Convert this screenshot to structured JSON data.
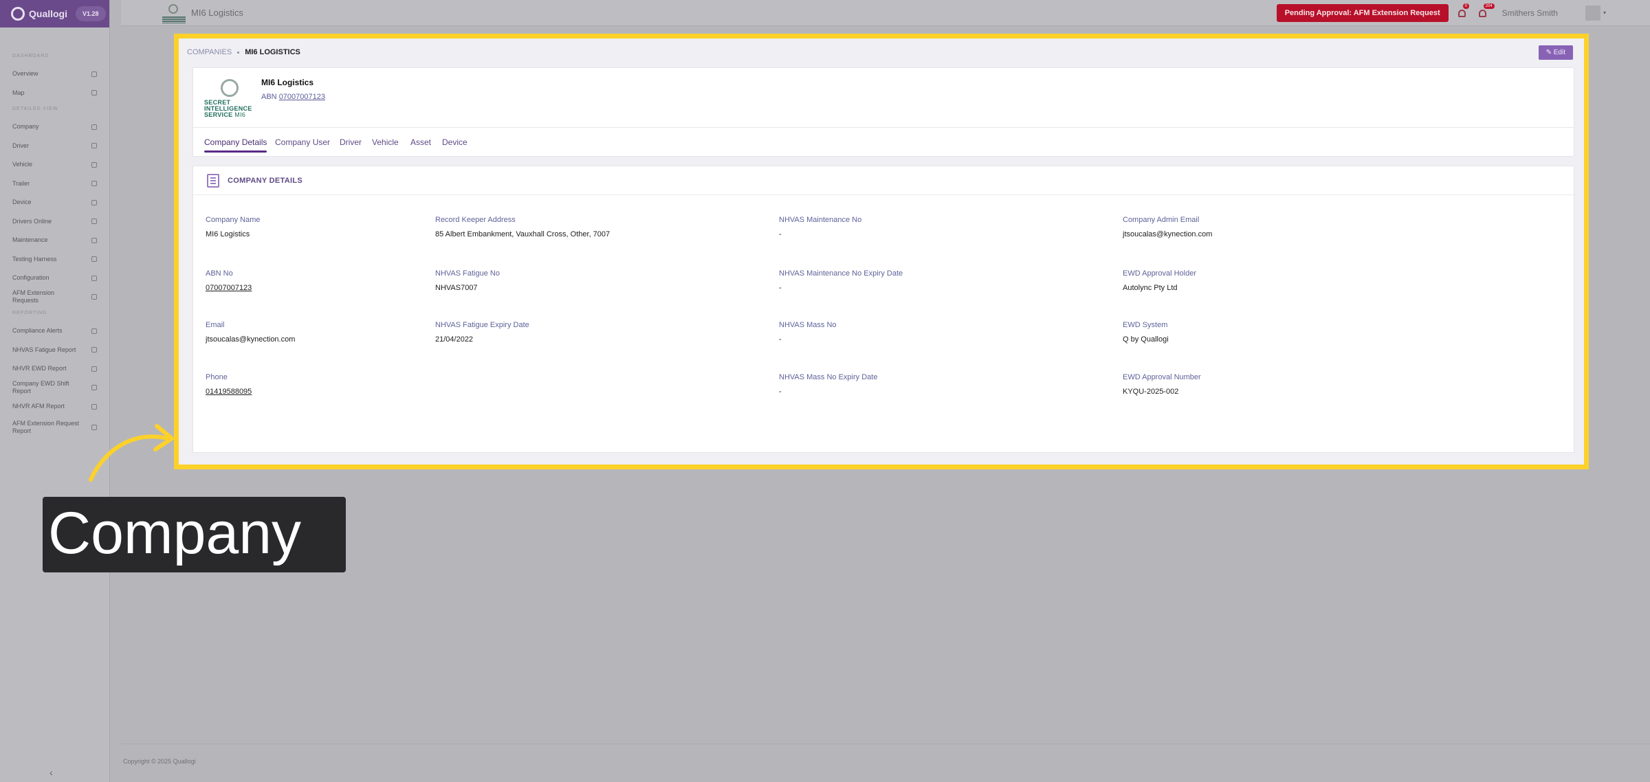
{
  "app": {
    "name": "Quallogi",
    "version": "V1.28"
  },
  "sidebar": {
    "sections": [
      {
        "title": "Dashboard",
        "items": [
          "Overview",
          "Map"
        ]
      },
      {
        "title": "Detailed View",
        "items": [
          "Company",
          "Driver",
          "Vehicle",
          "Trailer",
          "Device",
          "Drivers Online",
          "Maintenance",
          "Testing Harness",
          "Configuration",
          "AFM Extension Requests"
        ]
      },
      {
        "title": "Reporting",
        "items": [
          "Compliance Alerts",
          "NHVAS Fatigue Report",
          "NHVR EWD Report",
          "Company EWD Shift Report",
          "NHVR AFM Report",
          "AFM Extension Request Report"
        ]
      }
    ],
    "collapse_glyph": "‹"
  },
  "topbar": {
    "company": "MI6 Logistics",
    "pending_label": "Pending Approval: AFM Extension Request",
    "notif_badge_1": "0",
    "notif_badge_2": "204",
    "user_name": "Smithers Smith",
    "dropdown_glyph": "▾"
  },
  "breadcrumb": {
    "root": "COMPANIES",
    "current": "MI6 LOGISTICS"
  },
  "edit_label": "✎ Edit",
  "profile": {
    "logo_text_1": "SECRET",
    "logo_text_2": "INTELLIGENCE",
    "logo_text_3": "SERVICE",
    "logo_text_4": "MI6",
    "name": "MI6 Logistics",
    "abn_label": "ABN",
    "abn": "07007007123"
  },
  "tabs": [
    "Company Details",
    "Company User",
    "Driver",
    "Vehicle",
    "Asset",
    "Device"
  ],
  "details": {
    "title": "COMPANY DETAILS",
    "fields": {
      "company_name": {
        "label": "Company Name",
        "value": "MI6 Logistics"
      },
      "abn_no": {
        "label": "ABN No",
        "value": "07007007123"
      },
      "email": {
        "label": "Email",
        "value": "jtsoucalas@kynection.com"
      },
      "phone": {
        "label": "Phone",
        "value": "01419588095"
      },
      "record_keeper": {
        "label": "Record Keeper Address",
        "value": "85 Albert Embankment, Vauxhall Cross, Other, 7007"
      },
      "fatigue_no": {
        "label": "NHVAS Fatigue No",
        "value": "NHVAS7007"
      },
      "fatigue_expiry": {
        "label": "NHVAS Fatigue Expiry Date",
        "value": "21/04/2022"
      },
      "maint_no": {
        "label": "NHVAS Maintenance No",
        "value": "-"
      },
      "maint_expiry": {
        "label": "NHVAS Maintenance No Expiry Date",
        "value": "-"
      },
      "mass_no": {
        "label": "NHVAS Mass No",
        "value": "-"
      },
      "mass_expiry": {
        "label": "NHVAS Mass No Expiry Date",
        "value": "-"
      },
      "admin_email": {
        "label": "Company Admin Email",
        "value": "jtsoucalas@kynection.com"
      },
      "ewd_holder": {
        "label": "EWD Approval Holder",
        "value": "Autolync Pty Ltd"
      },
      "ewd_system": {
        "label": "EWD System",
        "value": "Q by Quallogi"
      },
      "ewd_number": {
        "label": "EWD Approval Number",
        "value": "KYQU-2025-002"
      }
    }
  },
  "callout": "Company",
  "footer": "Copyright © 2025 Quallogi",
  "colors": {
    "accent": "#6a4a8a",
    "pending": "#b8102a",
    "highlight": "#fcd12a"
  }
}
